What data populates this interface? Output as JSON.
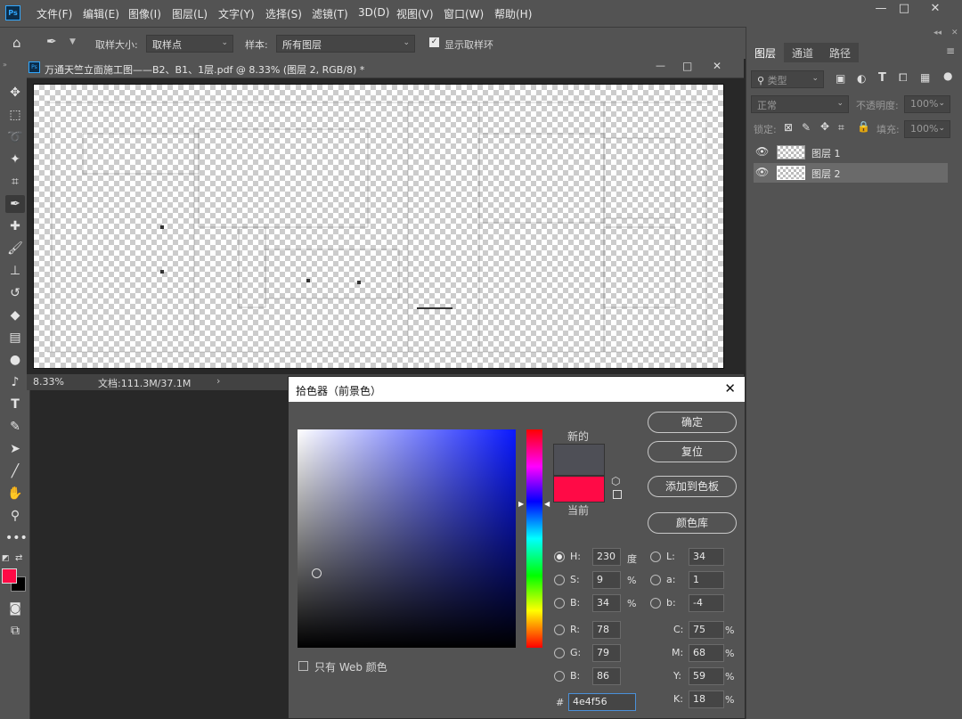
{
  "app": {
    "logo": "Ps"
  },
  "menu": [
    "文件(F)",
    "编辑(E)",
    "图像(I)",
    "图层(L)",
    "文字(Y)",
    "选择(S)",
    "滤镜(T)",
    "3D(D)",
    "视图(V)",
    "窗口(W)",
    "帮助(H)"
  ],
  "window_controls": {
    "minimize": "—",
    "maximize": "□",
    "close": "✕"
  },
  "options": {
    "sample_size_label": "取样大小:",
    "sample_size_value": "取样点",
    "sample_label": "样本:",
    "sample_value": "所有图层",
    "show_ring_label": "显示取样环",
    "show_ring_checked": true
  },
  "document": {
    "tab_title": "万通天竺立面施工图——B2、B1、1层.pdf @ 8.33% (图层 2, RGB/8) *",
    "zoom": "8.33%",
    "doc_info": "文档:111.3M/37.1M"
  },
  "panel": {
    "tabs": [
      "图层",
      "通道",
      "路径"
    ],
    "filter_kind": "类型",
    "blend_mode": "正常",
    "opacity_label": "不透明度:",
    "opacity_value": "100%",
    "lock_label": "锁定:",
    "fill_label": "填充:",
    "fill_value": "100%",
    "layers": [
      {
        "name": "图层 1",
        "visible": true,
        "selected": false
      },
      {
        "name": "图层 2",
        "visible": true,
        "selected": true
      }
    ]
  },
  "color_picker": {
    "title": "拾色器（前景色）",
    "new_label": "新的",
    "current_label": "当前",
    "new_color": "#4e4f56",
    "current_color": "#ff0a46",
    "buttons": {
      "ok": "确定",
      "reset": "复位",
      "add_swatch": "添加到色板",
      "libraries": "颜色库"
    },
    "web_only_label": "只有 Web 颜色",
    "hsb": {
      "H": "230",
      "H_unit": "度",
      "S": "9",
      "S_unit": "%",
      "B": "34",
      "B_unit": "%"
    },
    "lab": {
      "L": "34",
      "a": "1",
      "b": "-4"
    },
    "rgb": {
      "R": "78",
      "G": "79",
      "B": "86"
    },
    "cmyk": {
      "C": "75",
      "M": "68",
      "Y": "59",
      "K": "18",
      "unit": "%"
    },
    "hex_prefix": "#",
    "hex": "4e4f56",
    "hue_slider_level": 0.345,
    "saturation_fraction": 0.09,
    "brightness_fraction": 0.34
  },
  "foreground_color": "#ff0a46",
  "background_color": "#000000"
}
